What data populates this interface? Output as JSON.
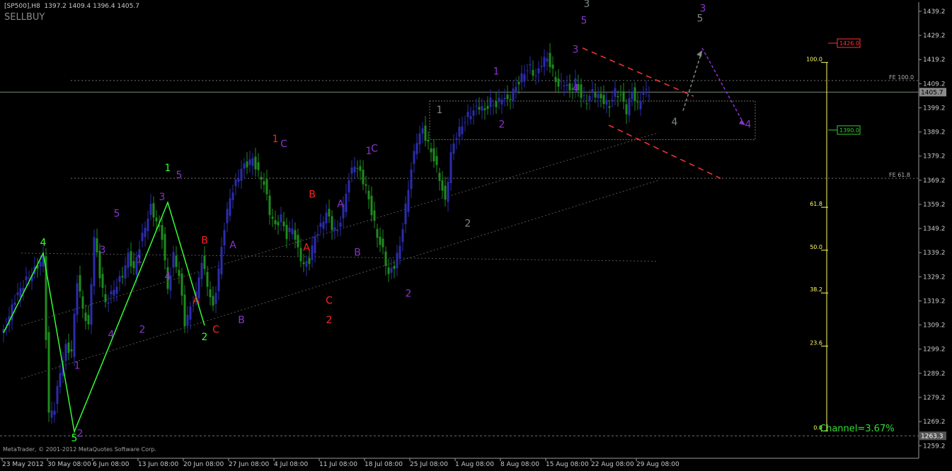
{
  "header": {
    "symbol_line": "[SP500],H8  1397.2 1409.4 1396.4 1405.7",
    "indicator": "SELLBUY"
  },
  "footer": {
    "copyright": "MetaTrader, © 2001-2012 MetaQuotes Software Corp.",
    "channel_label": "Channel=3.67%"
  },
  "colors": {
    "background": "#000000",
    "bull_bar": "#2c2cae",
    "bear_bar": "#1e8c1e",
    "grid": "#5a5a5a",
    "price_line": "#7a8a7a",
    "fib_line": "#ffff66",
    "wave_green": "#33ff33",
    "wave_purple": "#8833cc",
    "wave_red": "#ff2222",
    "wave_gray": "#7a8a80"
  },
  "chart_data": {
    "type": "candlestick",
    "symbol": "SP500",
    "timeframe": "H8",
    "ohlc_last": {
      "open": 1397.2,
      "high": 1409.4,
      "low": 1396.4,
      "close": 1405.7
    },
    "ylim": [
      1254,
      1443
    ],
    "y_ticks": [
      "1439.2",
      "1429.2",
      "1419.2",
      "1409.2",
      "1399.2",
      "1389.2",
      "1379.2",
      "1369.2",
      "1359.2",
      "1349.2",
      "1339.2",
      "1329.2",
      "1319.2",
      "1309.2",
      "1299.2",
      "1289.2",
      "1279.2",
      "1269.2",
      "1259.2"
    ],
    "x_ticks": [
      "23 May 2012",
      "30 May 08:00",
      "6 Jun 08:00",
      "13 Jun 08:00",
      "20 Jun 08:00",
      "27 Jun 08:00",
      "4 Jul 08:00",
      "11 Jul 08:00",
      "18 Jul 08:00",
      "25 Jul 08:00",
      "1 Aug 08:00",
      "8 Aug 08:00",
      "15 Aug 08:00",
      "22 Aug 08:00",
      "29 Aug 08:00"
    ],
    "current_price": "1405.7",
    "price_markers": [
      {
        "label": "1426.0",
        "value": 1426.0,
        "color": "#ff3333"
      },
      {
        "label": "1390.0",
        "value": 1390.0,
        "color": "#33cc33"
      },
      {
        "label": "1263.3",
        "value": 1263.3,
        "color": "#888888"
      }
    ],
    "fe_levels": [
      {
        "label": "FE 100.0",
        "value": 1410.5
      },
      {
        "label": "FE 61.8",
        "value": 1370.0
      }
    ],
    "fib_scale": [
      {
        "label": "100.0",
        "value": 1418.0
      },
      {
        "label": "61.8",
        "value": 1358.0
      },
      {
        "label": "50.0",
        "value": 1340.2
      },
      {
        "label": "38.2",
        "value": 1322.5
      },
      {
        "label": "23.6",
        "value": 1300.5
      },
      {
        "label": "0.0",
        "value": 1265.3
      }
    ],
    "path": [
      [
        0,
        1306
      ],
      [
        4,
        1320
      ],
      [
        8,
        1328
      ],
      [
        11,
        1332
      ],
      [
        14,
        1337
      ],
      [
        16,
        1272
      ],
      [
        18,
        1275
      ],
      [
        20,
        1290
      ],
      [
        22,
        1300
      ],
      [
        24,
        1298
      ],
      [
        26,
        1328
      ],
      [
        28,
        1316
      ],
      [
        30,
        1308
      ],
      [
        32,
        1346
      ],
      [
        34,
        1330
      ],
      [
        36,
        1318
      ],
      [
        38,
        1322
      ],
      [
        40,
        1326
      ],
      [
        42,
        1330
      ],
      [
        44,
        1338
      ],
      [
        46,
        1332
      ],
      [
        48,
        1342
      ],
      [
        50,
        1350
      ],
      [
        52,
        1358
      ],
      [
        54,
        1352
      ],
      [
        56,
        1346
      ],
      [
        58,
        1324
      ],
      [
        60,
        1338
      ],
      [
        62,
        1330
      ],
      [
        64,
        1310
      ],
      [
        66,
        1316
      ],
      [
        68,
        1322
      ],
      [
        70,
        1336
      ],
      [
        72,
        1326
      ],
      [
        74,
        1316
      ],
      [
        76,
        1332
      ],
      [
        78,
        1350
      ],
      [
        80,
        1362
      ],
      [
        82,
        1368
      ],
      [
        84,
        1374
      ],
      [
        86,
        1376
      ],
      [
        88,
        1378
      ],
      [
        90,
        1372
      ],
      [
        92,
        1368
      ],
      [
        94,
        1356
      ],
      [
        96,
        1350
      ],
      [
        98,
        1354
      ],
      [
        100,
        1346
      ],
      [
        102,
        1350
      ],
      [
        104,
        1340
      ],
      [
        106,
        1334
      ],
      [
        108,
        1336
      ],
      [
        110,
        1346
      ],
      [
        112,
        1350
      ],
      [
        114,
        1356
      ],
      [
        116,
        1350
      ],
      [
        118,
        1348
      ],
      [
        120,
        1358
      ],
      [
        122,
        1370
      ],
      [
        124,
        1376
      ],
      [
        126,
        1372
      ],
      [
        128,
        1366
      ],
      [
        130,
        1356
      ],
      [
        132,
        1346
      ],
      [
        134,
        1340
      ],
      [
        136,
        1330
      ],
      [
        138,
        1334
      ],
      [
        140,
        1342
      ],
      [
        142,
        1358
      ],
      [
        144,
        1374
      ],
      [
        146,
        1386
      ],
      [
        148,
        1390
      ],
      [
        150,
        1384
      ],
      [
        152,
        1378
      ],
      [
        154,
        1370
      ],
      [
        156,
        1360
      ],
      [
        158,
        1380
      ],
      [
        160,
        1388
      ],
      [
        162,
        1392
      ],
      [
        164,
        1396
      ],
      [
        166,
        1398
      ],
      [
        168,
        1400
      ],
      [
        170,
        1398
      ],
      [
        172,
        1402
      ],
      [
        174,
        1400
      ],
      [
        176,
        1404
      ],
      [
        178,
        1402
      ],
      [
        180,
        1406
      ],
      [
        182,
        1410
      ],
      [
        184,
        1414
      ],
      [
        186,
        1416
      ],
      [
        188,
        1412
      ],
      [
        190,
        1418
      ],
      [
        192,
        1420
      ],
      [
        194,
        1414
      ],
      [
        196,
        1408
      ],
      [
        198,
        1410
      ],
      [
        200,
        1406
      ],
      [
        202,
        1410
      ],
      [
        204,
        1404
      ],
      [
        206,
        1402
      ],
      [
        208,
        1406
      ],
      [
        210,
        1404
      ],
      [
        212,
        1402
      ],
      [
        214,
        1400
      ],
      [
        216,
        1406
      ],
      [
        218,
        1404
      ],
      [
        220,
        1398
      ],
      [
        222,
        1406
      ],
      [
        224,
        1400
      ],
      [
        226,
        1406
      ],
      [
        228,
        1405.7
      ]
    ],
    "waves": [
      {
        "text": "4",
        "color": "green",
        "x": 14,
        "y": 1342
      },
      {
        "text": "5",
        "color": "green",
        "x": 25,
        "y": 1261
      },
      {
        "text": "1",
        "color": "purple",
        "x": 26,
        "y": 1291
      },
      {
        "text": "2",
        "color": "purple",
        "x": 27,
        "y": 1263
      },
      {
        "text": "3",
        "color": "purple",
        "x": 35,
        "y": 1339
      },
      {
        "text": "4",
        "color": "purple",
        "x": 38,
        "y": 1304
      },
      {
        "text": "5",
        "color": "purple",
        "x": 40,
        "y": 1354
      },
      {
        "text": "1",
        "color": "purple",
        "x": 48,
        "y": 1335
      },
      {
        "text": "2",
        "color": "purple",
        "x": 49,
        "y": 1306
      },
      {
        "text": "3",
        "color": "purple",
        "x": 56,
        "y": 1361
      },
      {
        "text": "4",
        "color": "purple",
        "x": 58,
        "y": 1328
      },
      {
        "text": "1",
        "color": "green",
        "x": 58,
        "y": 1373
      },
      {
        "text": "5",
        "color": "purple",
        "x": 62,
        "y": 1370
      },
      {
        "text": "A",
        "color": "red",
        "x": 68,
        "y": 1318
      },
      {
        "text": "B",
        "color": "red",
        "x": 71,
        "y": 1343
      },
      {
        "text": "2",
        "color": "green",
        "x": 71,
        "y": 1303
      },
      {
        "text": "C",
        "color": "red",
        "x": 75,
        "y": 1306
      },
      {
        "text": "A",
        "color": "purple",
        "x": 81,
        "y": 1341
      },
      {
        "text": "B",
        "color": "purple",
        "x": 84,
        "y": 1310
      },
      {
        "text": "1",
        "color": "red",
        "x": 96,
        "y": 1385
      },
      {
        "text": "C",
        "color": "purple",
        "x": 99,
        "y": 1383
      },
      {
        "text": "A",
        "color": "red",
        "x": 107,
        "y": 1340
      },
      {
        "text": "B",
        "color": "red",
        "x": 109,
        "y": 1362
      },
      {
        "text": "C",
        "color": "red",
        "x": 115,
        "y": 1318
      },
      {
        "text": "2",
        "color": "red",
        "x": 115,
        "y": 1310
      },
      {
        "text": "A",
        "color": "purple",
        "x": 119,
        "y": 1358
      },
      {
        "text": "B",
        "color": "purple",
        "x": 125,
        "y": 1338
      },
      {
        "text": "1",
        "color": "purple",
        "x": 129,
        "y": 1380
      },
      {
        "text": "C",
        "color": "purple",
        "x": 131,
        "y": 1381
      },
      {
        "text": "2",
        "color": "purple",
        "x": 143,
        "y": 1321
      },
      {
        "text": "1",
        "color": "gray",
        "x": 154,
        "y": 1397
      },
      {
        "text": "2",
        "color": "gray",
        "x": 164,
        "y": 1350
      },
      {
        "text": "1",
        "color": "purple",
        "x": 174,
        "y": 1413
      },
      {
        "text": "2",
        "color": "purple",
        "x": 176,
        "y": 1391
      },
      {
        "text": "3",
        "color": "purple",
        "x": 202,
        "y": 1422
      },
      {
        "text": "5",
        "color": "purple",
        "x": 205,
        "y": 1434
      },
      {
        "text": "3",
        "color": "gray",
        "x": 206,
        "y": 1441
      },
      {
        "text": "4",
        "color": "purple",
        "x": 202,
        "y": 1406
      },
      {
        "text": "4",
        "color": "gray",
        "x": 237,
        "y": 1392
      },
      {
        "text": "5",
        "color": "gray",
        "x": 246,
        "y": 1435
      },
      {
        "text": "3",
        "color": "purple",
        "x": 247,
        "y": 1439
      },
      {
        "text": "4",
        "color": "purple",
        "x": 263,
        "y": 1391
      }
    ]
  }
}
